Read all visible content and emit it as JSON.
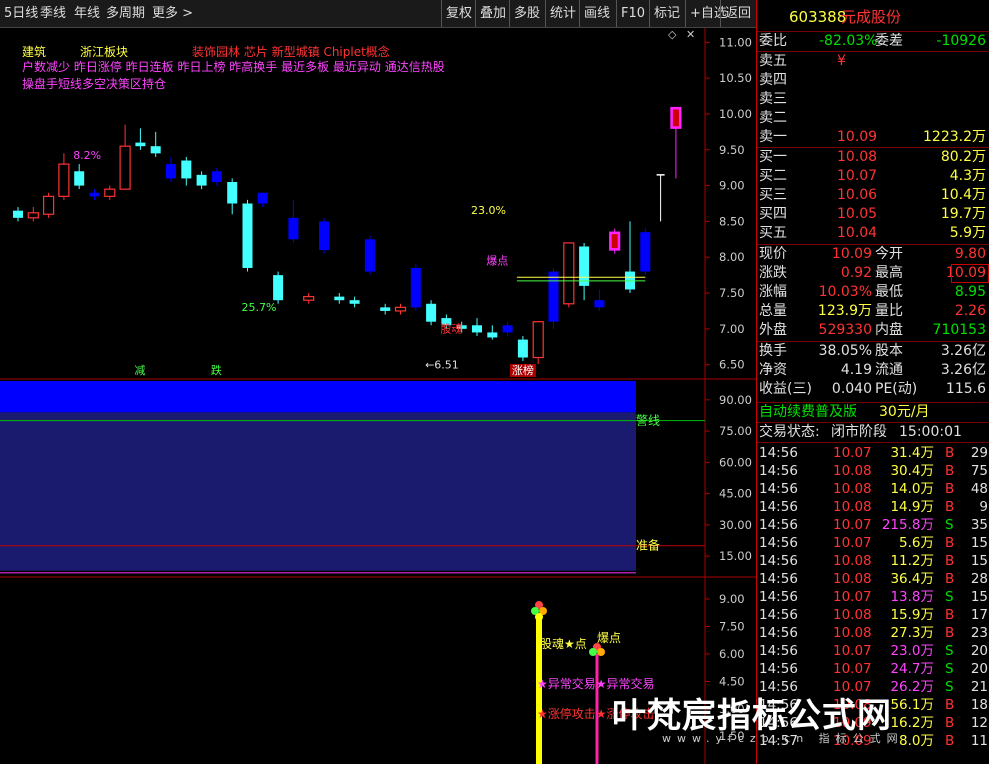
{
  "toolbar": {
    "left_tabs": [
      "5日线",
      "季线",
      "年线",
      "多周期",
      "更多 >"
    ],
    "right_buttons": [
      "复权",
      "叠加",
      "多股",
      "统计",
      "画线",
      "F10",
      "标记",
      "+自选",
      "返回"
    ]
  },
  "info_lines": {
    "line1_a": "建筑",
    "line1_b": "浙江板块",
    "line1_c": "装饰园林 芯片 新型城镇 Chiplet概念",
    "line2": "户数减少 昨日涨停 昨日连板 昨日上榜 昨高换手 最近多板 最近异动 通达信热股",
    "line3": "操盘手短线多空决策区持仓"
  },
  "colors": {
    "up": "#ff3333",
    "down": "#0000ff",
    "cyan": "#44ffff",
    "magenta": "#ff22ff",
    "yellow": "#ffff00",
    "green": "#00d000",
    "gray": "#aaaaaa"
  },
  "chart_data": [
    {
      "type": "candlestick",
      "ylim": [
        6.3,
        11.2
      ],
      "yticks": [
        11.0,
        10.5,
        10.0,
        9.5,
        9.0,
        8.5,
        8.0,
        7.5,
        7.0,
        6.5
      ],
      "candles": [
        {
          "o": 8.65,
          "c": 8.55,
          "h": 8.7,
          "l": 8.5,
          "s": "cyan"
        },
        {
          "o": 8.55,
          "c": 8.62,
          "h": 8.7,
          "l": 8.5,
          "s": "up"
        },
        {
          "o": 8.6,
          "c": 8.85,
          "h": 8.9,
          "l": 8.55,
          "s": "up"
        },
        {
          "o": 8.85,
          "c": 9.3,
          "h": 9.45,
          "l": 8.8,
          "s": "up"
        },
        {
          "o": 9.2,
          "c": 9.0,
          "h": 9.3,
          "l": 8.95,
          "s": "cyan"
        },
        {
          "o": 8.9,
          "c": 8.85,
          "h": 8.95,
          "l": 8.8,
          "s": "down"
        },
        {
          "o": 8.95,
          "c": 8.85,
          "h": 9.0,
          "l": 8.8,
          "s": "up"
        },
        {
          "o": 8.95,
          "c": 9.55,
          "h": 9.85,
          "l": 8.95,
          "s": "up"
        },
        {
          "o": 9.6,
          "c": 9.55,
          "h": 9.8,
          "l": 9.5,
          "s": "cyan"
        },
        {
          "o": 9.55,
          "c": 9.45,
          "h": 9.75,
          "l": 9.4,
          "s": "cyan"
        },
        {
          "o": 9.3,
          "c": 9.1,
          "h": 9.4,
          "l": 9.05,
          "s": "down"
        },
        {
          "o": 9.35,
          "c": 9.1,
          "h": 9.4,
          "l": 9.0,
          "s": "cyan"
        },
        {
          "o": 9.15,
          "c": 9.0,
          "h": 9.2,
          "l": 8.95,
          "s": "cyan"
        },
        {
          "o": 9.2,
          "c": 9.05,
          "h": 9.25,
          "l": 9.0,
          "s": "down"
        },
        {
          "o": 9.05,
          "c": 8.75,
          "h": 9.1,
          "l": 8.6,
          "s": "cyan"
        },
        {
          "o": 8.75,
          "c": 7.85,
          "h": 8.8,
          "l": 7.8,
          "s": "cyan"
        },
        {
          "o": 8.9,
          "c": 8.75,
          "h": 8.9,
          "l": 8.7,
          "s": "down"
        },
        {
          "o": 7.75,
          "c": 7.4,
          "h": 7.8,
          "l": 7.35,
          "s": "cyan"
        },
        {
          "o": 8.55,
          "c": 8.25,
          "h": 8.8,
          "l": 8.2,
          "s": "down"
        },
        {
          "o": 7.4,
          "c": 7.45,
          "h": 7.5,
          "l": 7.35,
          "s": "up"
        },
        {
          "o": 8.5,
          "c": 8.1,
          "h": 8.55,
          "l": 8.05,
          "s": "down"
        },
        {
          "o": 7.45,
          "c": 7.4,
          "h": 7.5,
          "l": 7.35,
          "s": "cyan"
        },
        {
          "o": 7.4,
          "c": 7.35,
          "h": 7.45,
          "l": 7.3,
          "s": "cyan"
        },
        {
          "o": 8.25,
          "c": 7.8,
          "h": 8.3,
          "l": 7.75,
          "s": "down"
        },
        {
          "o": 7.3,
          "c": 7.25,
          "h": 7.35,
          "l": 7.2,
          "s": "cyan"
        },
        {
          "o": 7.25,
          "c": 7.3,
          "h": 7.35,
          "l": 7.2,
          "s": "up"
        },
        {
          "o": 7.85,
          "c": 7.3,
          "h": 7.9,
          "l": 7.25,
          "s": "down"
        },
        {
          "o": 7.35,
          "c": 7.1,
          "h": 7.4,
          "l": 7.05,
          "s": "cyan"
        },
        {
          "o": 7.15,
          "c": 7.05,
          "h": 7.2,
          "l": 7.0,
          "s": "cyan"
        },
        {
          "o": 7.05,
          "c": 7.0,
          "h": 7.1,
          "l": 6.95,
          "s": "cyan"
        },
        {
          "o": 7.05,
          "c": 6.95,
          "h": 7.15,
          "l": 6.9,
          "s": "cyan"
        },
        {
          "o": 6.95,
          "c": 6.88,
          "h": 7.05,
          "l": 6.85,
          "s": "cyan"
        },
        {
          "o": 7.05,
          "c": 6.95,
          "h": 7.1,
          "l": 6.9,
          "s": "down"
        },
        {
          "o": 6.85,
          "c": 6.6,
          "h": 6.9,
          "l": 6.55,
          "s": "cyan"
        },
        {
          "o": 6.6,
          "c": 7.1,
          "h": 7.1,
          "l": 6.51,
          "s": "up"
        },
        {
          "o": 7.8,
          "c": 7.1,
          "h": 7.85,
          "l": 7.0,
          "s": "down"
        },
        {
          "o": 7.35,
          "c": 8.2,
          "h": 8.2,
          "l": 7.3,
          "s": "up"
        },
        {
          "o": 8.15,
          "c": 7.6,
          "h": 8.2,
          "l": 7.4,
          "s": "cyan"
        },
        {
          "o": 7.4,
          "c": 7.3,
          "h": 7.55,
          "l": 7.25,
          "s": "down"
        },
        {
          "o": 8.35,
          "c": 8.1,
          "h": 8.4,
          "l": 8.05,
          "s": "magenta"
        },
        {
          "o": 7.8,
          "c": 7.55,
          "h": 8.5,
          "l": 7.5,
          "s": "cyan"
        },
        {
          "o": 8.35,
          "c": 7.8,
          "h": 8.4,
          "l": 7.75,
          "s": "down"
        },
        {
          "o": 9.15,
          "c": 9.15,
          "h": 9.15,
          "l": 8.5,
          "s": "ma"
        },
        {
          "o": 9.8,
          "c": 10.09,
          "h": 10.09,
          "l": 9.1,
          "s": "magenta"
        }
      ],
      "labels": [
        {
          "text": "8.2%",
          "i": 4,
          "p": 9.37,
          "color": "#ff44ff"
        },
        {
          "text": "25.7%",
          "i": 15,
          "p": 7.25,
          "color": "#44ff44"
        },
        {
          "text": "23.0%",
          "i": 30,
          "p": 8.6,
          "color": "#ffff44"
        },
        {
          "text": "爆点",
          "i": 31,
          "p": 7.9,
          "color": "#ff44ff"
        },
        {
          "text": "股魂",
          "i": 28,
          "p": 6.95,
          "color": "#ff3333"
        },
        {
          "text": "←6.51",
          "i": 27,
          "p": 6.45,
          "color": "#dddddd"
        }
      ],
      "bottom_markers": [
        {
          "text": "减",
          "i": 8,
          "color": "#44ff44"
        },
        {
          "text": "跌",
          "i": 13,
          "color": "#44ff44"
        },
        {
          "text": "涨榜",
          "i": 33,
          "color": "#ffffff",
          "bg": "#aa0000"
        }
      ]
    },
    {
      "type": "area",
      "ylim": [
        5,
        100
      ],
      "yticks": [
        90.0,
        75.0,
        60.0,
        45.0,
        30.0,
        15.0
      ],
      "upper_band": [
        84,
        99
      ],
      "lower_band": [
        8,
        84
      ],
      "warn_line": 80,
      "ready_line": 20,
      "warn_label": "警线",
      "ready_label": "准备"
    },
    {
      "type": "signal",
      "yticks": [
        9.0,
        7.5,
        6.0,
        4.5,
        3.0
      ],
      "bottom_tick": "1.50",
      "texts": [
        {
          "text": "股魂★点",
          "color": "#ffff44"
        },
        {
          "text": "爆点",
          "color": "#ffff44"
        },
        {
          "text": "★异常交易★异常交易",
          "color": "#ff44ff"
        },
        {
          "text": "★涨停攻击★涨停攻击",
          "color": "#ff3333"
        }
      ]
    }
  ],
  "quote": {
    "code": "603388",
    "name": "元成股份",
    "weibi_label": "委比",
    "weibi": "-82.03%",
    "weicha_label": "委差",
    "weicha": "-10926",
    "asks": [
      {
        "label": "卖五",
        "price": "¥",
        "vol": ""
      },
      {
        "label": "卖四",
        "price": "",
        "vol": ""
      },
      {
        "label": "卖三",
        "price": "",
        "vol": ""
      },
      {
        "label": "卖二",
        "price": "",
        "vol": ""
      },
      {
        "label": "卖一",
        "price": "10.09",
        "vol": "1223.2万"
      }
    ],
    "bids": [
      {
        "label": "买一",
        "price": "10.08",
        "vol": "80.2万"
      },
      {
        "label": "买二",
        "price": "10.07",
        "vol": "4.3万"
      },
      {
        "label": "买三",
        "price": "10.06",
        "vol": "10.4万"
      },
      {
        "label": "买四",
        "price": "10.05",
        "vol": "19.7万"
      },
      {
        "label": "买五",
        "price": "10.04",
        "vol": "5.9万"
      }
    ],
    "stats": [
      {
        "l1": "现价",
        "v1": "10.09",
        "l2": "今开",
        "v2": "9.80"
      },
      {
        "l1": "涨跌",
        "v1": "0.92",
        "l2": "最高",
        "v2": "10.09"
      },
      {
        "l1": "涨幅",
        "v1": "10.03%",
        "l2": "最低",
        "v2": "8.95"
      },
      {
        "l1": "总量",
        "v1": "123.9万",
        "l2": "量比",
        "v2": "2.26"
      },
      {
        "l1": "外盘",
        "v1": "529330",
        "l2": "内盘",
        "v2": "710153"
      }
    ],
    "stats2": [
      {
        "l1": "换手",
        "v1": "38.05%",
        "l2": "股本",
        "v2": "3.26亿"
      },
      {
        "l1": "净资",
        "v1": "4.19",
        "l2": "流通",
        "v2": "3.26亿"
      },
      {
        "l1": "收益(三)",
        "v1": "0.040",
        "l2": "PE(动)",
        "v2": "115.6"
      }
    ],
    "promo": "自动续费普及版",
    "promo_price": "30元/月",
    "status_label": "交易状态:",
    "status_value": "闭市阶段",
    "status_time": "15:00:01"
  },
  "trades": [
    {
      "t": "14:56",
      "p": "10.07",
      "v": "31.4万",
      "d": "B",
      "n": "29"
    },
    {
      "t": "14:56",
      "p": "10.08",
      "v": "30.4万",
      "d": "B",
      "n": "75"
    },
    {
      "t": "14:56",
      "p": "10.08",
      "v": "14.0万",
      "d": "B",
      "n": "48"
    },
    {
      "t": "14:56",
      "p": "10.08",
      "v": "14.9万",
      "d": "B",
      "n": "9"
    },
    {
      "t": "14:56",
      "p": "10.07",
      "v": "215.8万",
      "d": "S",
      "n": "35"
    },
    {
      "t": "14:56",
      "p": "10.07",
      "v": "5.6万",
      "d": "B",
      "n": "15"
    },
    {
      "t": "14:56",
      "p": "10.08",
      "v": "11.2万",
      "d": "B",
      "n": "15"
    },
    {
      "t": "14:56",
      "p": "10.08",
      "v": "36.4万",
      "d": "B",
      "n": "28"
    },
    {
      "t": "14:56",
      "p": "10.07",
      "v": "13.8万",
      "d": "S",
      "n": "15"
    },
    {
      "t": "14:56",
      "p": "10.08",
      "v": "15.9万",
      "d": "B",
      "n": "17"
    },
    {
      "t": "14:56",
      "p": "10.08",
      "v": "27.3万",
      "d": "B",
      "n": "23"
    },
    {
      "t": "14:56",
      "p": "10.07",
      "v": "23.0万",
      "d": "S",
      "n": "20"
    },
    {
      "t": "14:56",
      "p": "10.07",
      "v": "24.7万",
      "d": "S",
      "n": "20"
    },
    {
      "t": "14:56",
      "p": "10.07",
      "v": "26.2万",
      "d": "S",
      "n": "21"
    },
    {
      "t": "14:56",
      "p": "10.08",
      "v": "56.1万",
      "d": "B",
      "n": "18"
    },
    {
      "t": "14:56",
      "p": "10.09",
      "v": "16.2万",
      "d": "B",
      "n": "12"
    },
    {
      "t": "14:57",
      "p": "10.09",
      "v": "8.0万",
      "d": "B",
      "n": "11"
    }
  ],
  "watermark": {
    "title": "叶梵宸指标公式网",
    "url": "www.yfczb.cn 指标公式网"
  }
}
